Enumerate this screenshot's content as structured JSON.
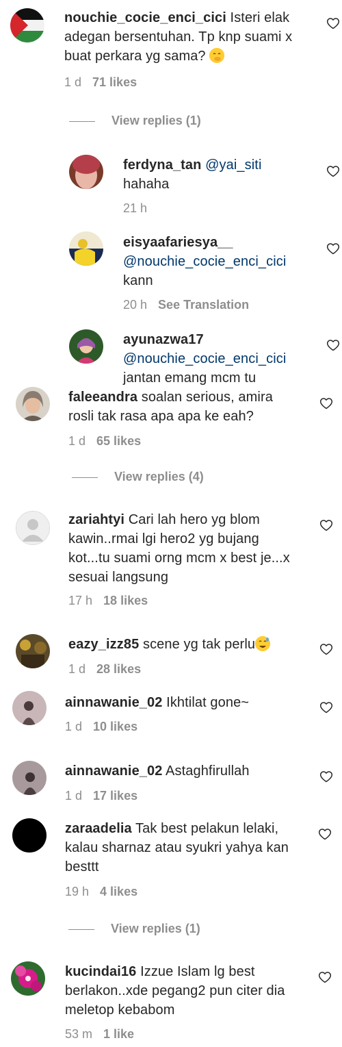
{
  "comments": [
    {
      "username": "nouchie_cocie_enci_cici",
      "text": "Isteri elak adegan bersentuhan. Tp knp suami x buat perkara yg sama?",
      "emoji": "face-with-hand-over-mouth",
      "time": "1 d",
      "likes": "71 likes",
      "view_replies": "View replies (1)"
    },
    {
      "username": "faleeandra",
      "text": "soalan serious, amira rosli tak rasa apa apa ke eah?",
      "time": "1 d",
      "likes": "65 likes",
      "view_replies": "View replies (4)"
    },
    {
      "username": "zariahtyi",
      "text": "Cari lah hero yg blom kawin..rmai lgi hero2 yg bujang kot...tu suami orng mcm x best je...x sesuai langsung",
      "time": "17 h",
      "likes": "18 likes"
    },
    {
      "username": "eazy_izz85",
      "text": "scene yg tak perlu",
      "emoji": "grinning-sweat",
      "time": "1 d",
      "likes": "28 likes"
    },
    {
      "username": "ainnawanie_02",
      "text": "Ikhtilat gone~",
      "time": "1 d",
      "likes": "10 likes"
    },
    {
      "username": "ainnawanie_02",
      "text": "Astaghfirullah",
      "time": "1 d",
      "likes": "17 likes"
    },
    {
      "username": "zaraadelia",
      "text": "Tak best pelakun lelaki, kalau sharnaz atau syukri yahya kan besttt",
      "time": "19 h",
      "likes": "4 likes",
      "view_replies": "View replies (1)"
    },
    {
      "username": "kucindai16",
      "text": "Izzue Islam lg best berlakon..xde pegang2 pun citer dia meletop kebabom",
      "time": "53 m",
      "likes": "1 like"
    }
  ],
  "replies": [
    {
      "username": "ferdyna_tan",
      "mention": "@yai_siti",
      "text": "hahaha",
      "time": "21 h"
    },
    {
      "username": "eisyaafariesya__",
      "mention": "@nouchie_cocie_enci_cici",
      "text": "kann",
      "time": "20 h",
      "translate": "See Translation"
    },
    {
      "username": "ayunazwa17",
      "mention": "@nouchie_cocie_enci_cici",
      "text": "jantan emang mcm tu"
    }
  ],
  "colors": {
    "text": "#262626",
    "meta": "#8e8e8e",
    "mention": "#00376b",
    "background": "#ffffff"
  }
}
